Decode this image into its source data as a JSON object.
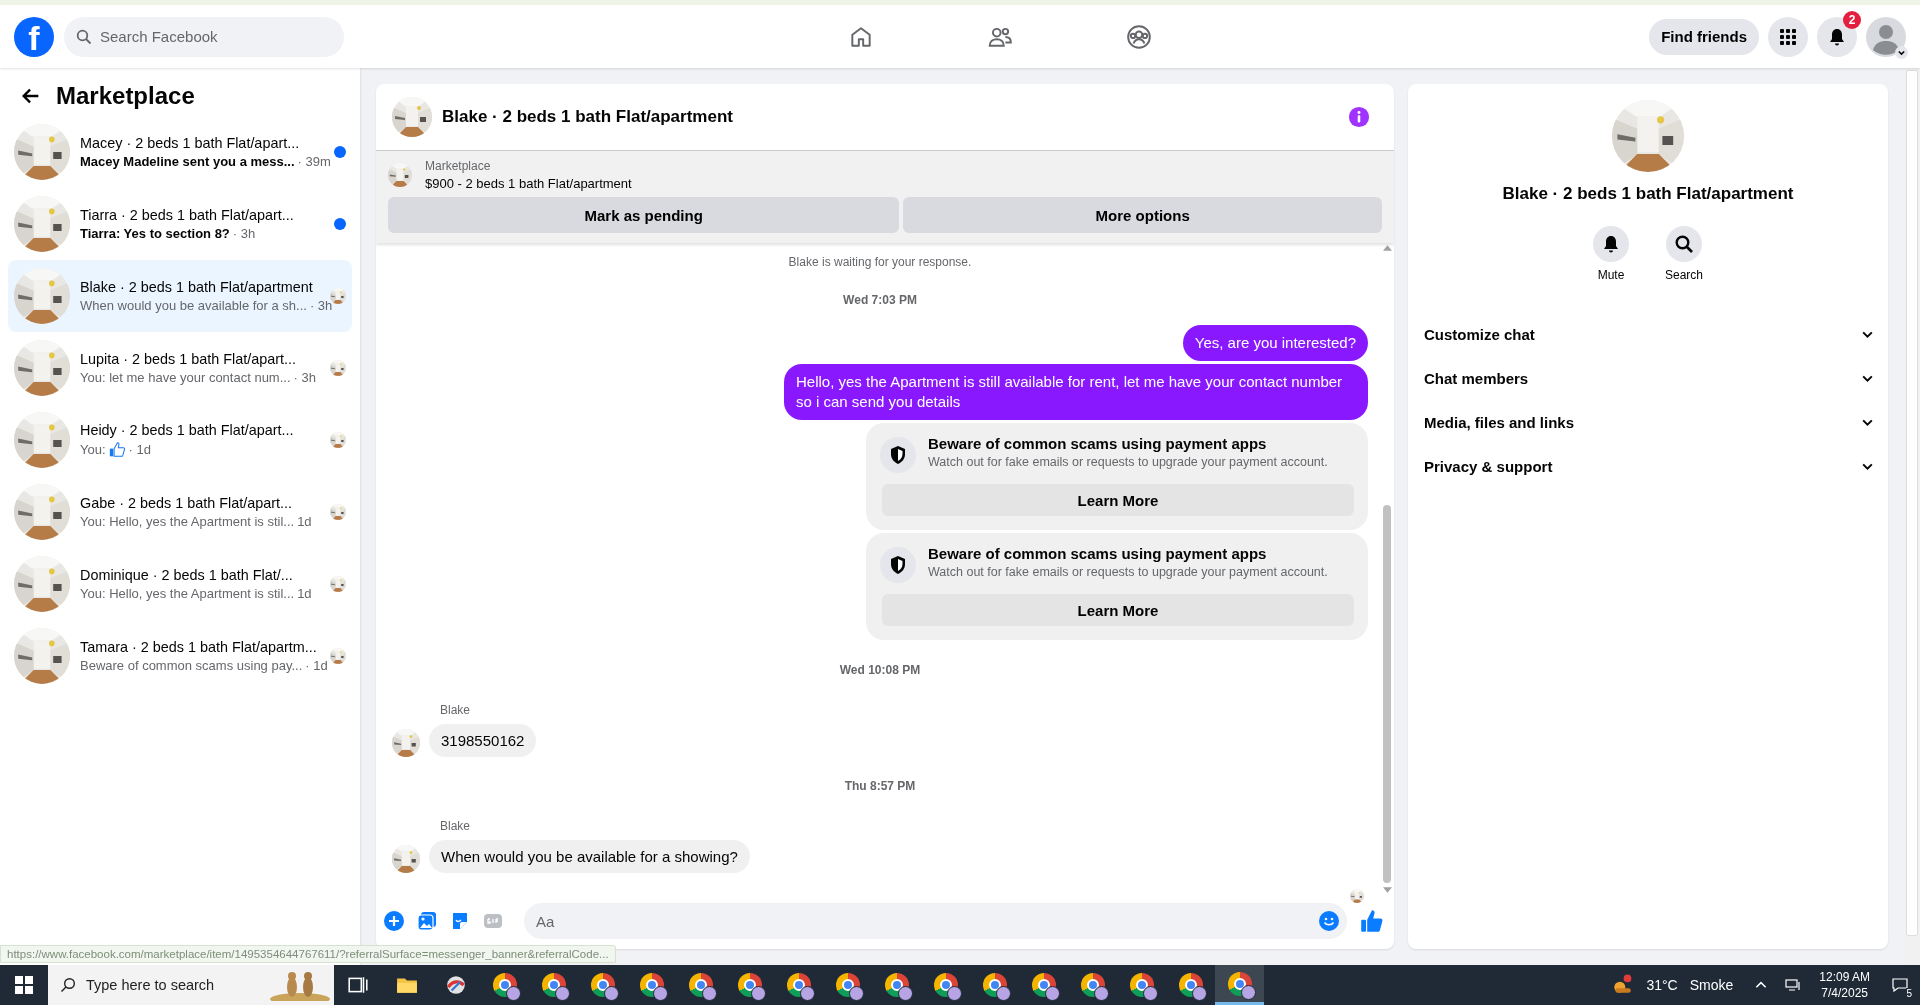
{
  "topbar": {
    "logo": "f",
    "search": {
      "placeholder": "Search Facebook"
    },
    "find_friends": "Find friends",
    "notification_count": "2"
  },
  "sidebar": {
    "title": "Marketplace",
    "conversations": [
      {
        "title": "Macey · 2 beds 1 bath Flat/apart...",
        "preview": "Macey Madeline sent you a mess...",
        "time": "· 39m",
        "unread": true,
        "selected": false,
        "like": false
      },
      {
        "title": "Tiarra · 2 beds 1 bath Flat/apart...",
        "preview": "Tiarra: Yes to section 8?",
        "time": "· 3h",
        "unread": true,
        "selected": false,
        "like": false
      },
      {
        "title": "Blake · 2 beds 1 bath Flat/apartment",
        "preview": "When would you be available for a sh...",
        "time": "· 3h",
        "unread": false,
        "selected": true,
        "like": false
      },
      {
        "title": "Lupita · 2 beds 1 bath Flat/apart...",
        "preview": "You: let me have your contact num...",
        "time": "· 3h",
        "unread": false,
        "selected": false,
        "like": false
      },
      {
        "title": "Heidy · 2 beds 1 bath Flat/apart...",
        "preview": "You:",
        "time": "· 1d",
        "unread": false,
        "selected": false,
        "like": true
      },
      {
        "title": "Gabe · 2 beds 1 bath Flat/apart...",
        "preview": "You: Hello, yes the Apartment is stil...",
        "time": "1d",
        "unread": false,
        "selected": false,
        "like": false
      },
      {
        "title": "Dominique · 2 beds 1 bath Flat/...",
        "preview": "You: Hello, yes the Apartment is stil...",
        "time": "1d",
        "unread": false,
        "selected": false,
        "like": false
      },
      {
        "title": "Tamara · 2 beds 1 bath Flat/apartm...",
        "preview": "Beware of common scams using pay...",
        "time": "· 1d",
        "unread": false,
        "selected": false,
        "like": false
      }
    ]
  },
  "chat": {
    "title": "Blake · 2 beds 1 bath Flat/apartment",
    "listing_label": "Marketplace",
    "listing": "$900 - 2 beds 1 bath Flat/apartment",
    "actions": [
      "Mark as pending",
      "More options"
    ],
    "messages": [
      {
        "kind": "notice",
        "text": "Blake is waiting for your response."
      },
      {
        "kind": "timestamp",
        "text": "Wed 7:03 PM"
      },
      {
        "kind": "outgoing",
        "text": "Yes, are you interested?"
      },
      {
        "kind": "outgoing",
        "text": "Hello, yes the Apartment is still available for rent, let me have your contact number so i can send you details"
      },
      {
        "kind": "warning",
        "title": "Beware of common scams using payment apps",
        "text": "Watch out for fake emails or requests to upgrade your payment account.",
        "button": "Learn More"
      },
      {
        "kind": "warning",
        "title": "Beware of common scams using payment apps",
        "text": "Watch out for fake emails or requests to upgrade your payment account.",
        "button": "Learn More"
      },
      {
        "kind": "timestamp",
        "text": "Wed 10:08 PM"
      },
      {
        "kind": "incoming",
        "sender": "Blake",
        "text": "3198550162"
      },
      {
        "kind": "timestamp",
        "text": "Thu 8:57 PM"
      },
      {
        "kind": "incoming",
        "sender": "Blake",
        "text": "When would you be available for a showing?"
      }
    ],
    "composer": {
      "placeholder": "Aa"
    }
  },
  "details": {
    "title": "Blake · 2 beds 1 bath Flat/apartment",
    "actions": [
      {
        "kind": "mute",
        "label": "Mute"
      },
      {
        "kind": "search",
        "label": "Search"
      }
    ],
    "sections": [
      "Customize chat",
      "Chat members",
      "Media, files and links",
      "Privacy & support"
    ]
  },
  "status_url": "https://www.facebook.com/marketplace/item/1495354644767611/?referralSurface=messenger_banner&referralCode...",
  "taskbar": {
    "search": {
      "placeholder": "Type here to search"
    },
    "apps": [
      {
        "kind": "explorer",
        "selected": false
      },
      {
        "kind": "app",
        "selected": false
      },
      {
        "kind": "browser",
        "selected": false
      },
      {
        "kind": "browser",
        "selected": false
      },
      {
        "kind": "browser",
        "selected": false
      },
      {
        "kind": "browser",
        "selected": false
      },
      {
        "kind": "browser",
        "selected": false
      },
      {
        "kind": "browser",
        "selected": false
      },
      {
        "kind": "browser",
        "selected": false
      },
      {
        "kind": "browser",
        "selected": false
      },
      {
        "kind": "browser",
        "selected": false
      },
      {
        "kind": "browser",
        "selected": false
      },
      {
        "kind": "browser",
        "selected": false
      },
      {
        "kind": "browser",
        "selected": false
      },
      {
        "kind": "browser",
        "selected": false
      },
      {
        "kind": "browser",
        "selected": false
      },
      {
        "kind": "browser",
        "selected": false
      },
      {
        "kind": "browser",
        "selected": true
      }
    ],
    "temperature": "31°C",
    "weather": "Smoke",
    "time": "12:09 AM",
    "date": "7/4/2025",
    "notification_count": "5"
  }
}
